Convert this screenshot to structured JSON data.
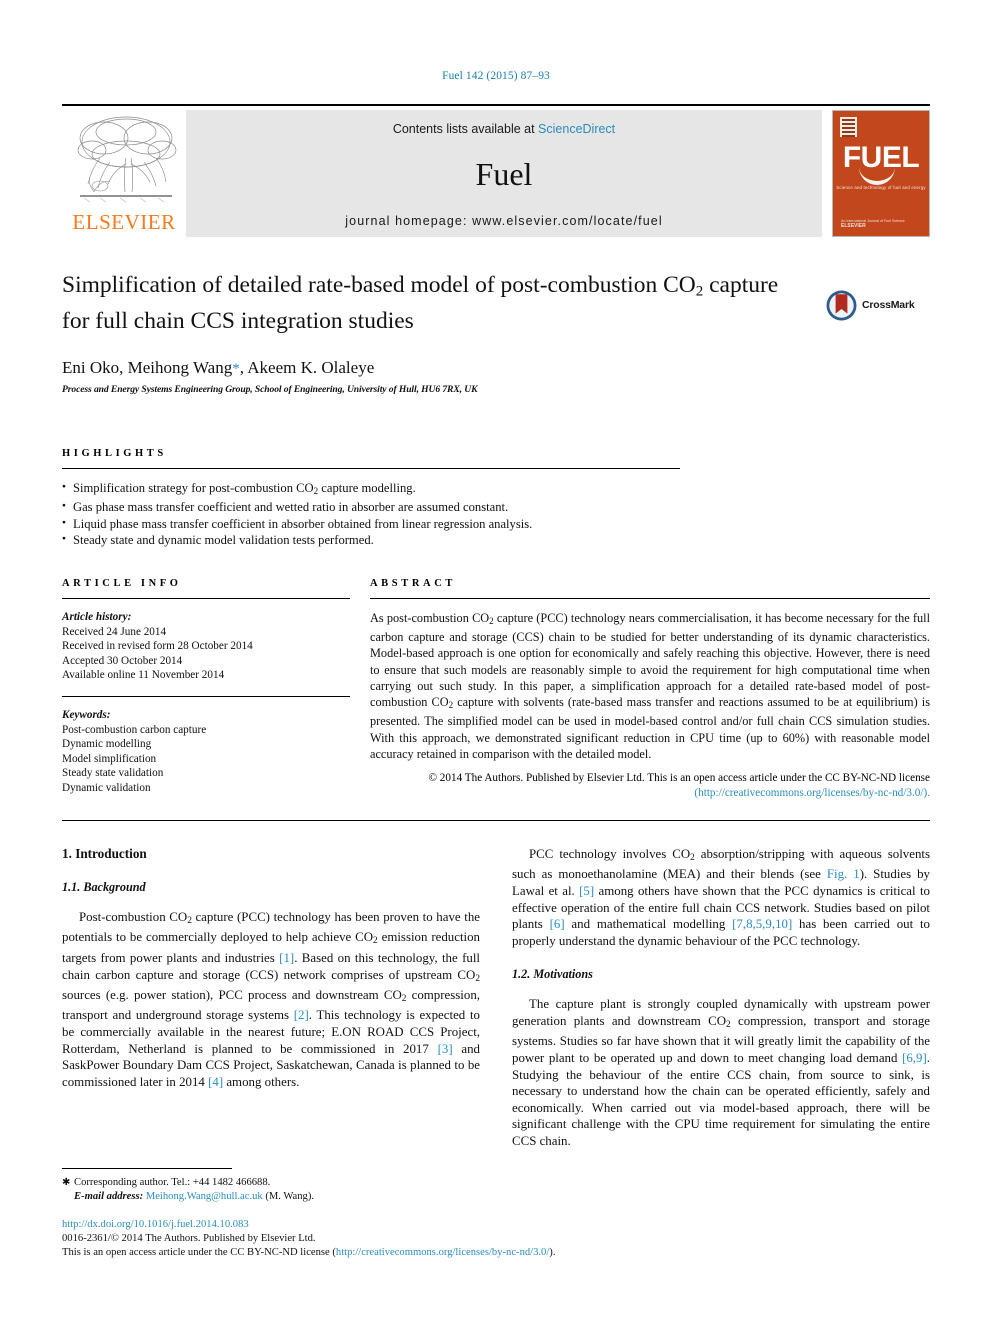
{
  "running_head": "Fuel 142 (2015) 87–93",
  "masthead": {
    "publisher_name": "ELSEVIER",
    "contents_prefix": "Contents lists available at ",
    "contents_link": "ScienceDirect",
    "journal_title": "Fuel",
    "journal_homepage": "journal homepage: www.elsevier.com/locate/fuel",
    "cover": {
      "wordmark": "FUEL",
      "subtitle": "Science and technology of fuel and energy",
      "footer_small": "An International Journal of Fuel Science",
      "footer_bold": "ELSEVIER"
    }
  },
  "article": {
    "title_line1": "Simplification of detailed rate-based model of post-combustion CO",
    "title_sub1": "2",
    "title_line2": "capture for full chain CCS integration studies",
    "crossmark_label": "CrossMark",
    "authors_plain": "Eni Oko, Meihong Wang",
    "corresponding_star": "*",
    "authors_rest": ", Akeem K. Olaleye",
    "affiliation": "Process and Energy Systems Engineering Group, School of Engineering, University of Hull, HU6 7RX, UK"
  },
  "highlights": {
    "heading": "HIGHLIGHTS",
    "items": [
      {
        "pre": "Simplification strategy for post-combustion CO",
        "sub": "2",
        "post": " capture modelling."
      },
      {
        "pre": "Gas phase mass transfer coefficient and wetted ratio in absorber are assumed constant.",
        "sub": "",
        "post": ""
      },
      {
        "pre": "Liquid phase mass transfer coefficient in absorber obtained from linear regression analysis.",
        "sub": "",
        "post": ""
      },
      {
        "pre": "Steady state and dynamic model validation tests performed.",
        "sub": "",
        "post": ""
      }
    ]
  },
  "article_info": {
    "heading": "ARTICLE INFO",
    "history_label": "Article history:",
    "history": [
      "Received 24 June 2014",
      "Received in revised form 28 October 2014",
      "Accepted 30 October 2014",
      "Available online 11 November 2014"
    ],
    "keywords_label": "Keywords:",
    "keywords": [
      "Post-combustion carbon capture",
      "Dynamic modelling",
      "Model simplification",
      "Steady state validation",
      "Dynamic validation"
    ]
  },
  "abstract": {
    "heading": "ABSTRACT",
    "p1_a": "As post-combustion CO",
    "p1_sub1": "2",
    "p1_b": " capture (PCC) technology nears commercialisation, it has become necessary for the full carbon capture and storage (CCS) chain to be studied for better understanding of its dynamic characteristics. Model-based approach is one option for economically and safely reaching this objective. However, there is need to ensure that such models are reasonably simple to avoid the requirement for high computational time when carrying out such study. In this paper, a simplification approach for a detailed rate-based model of post-combustion CO",
    "p1_sub2": "2",
    "p1_c": " capture with solvents (rate-based mass transfer and reactions assumed to be at equilibrium) is presented. The simplified model can be used in model-based control and/or full chain CCS simulation studies. With this approach, we demonstrated significant reduction in CPU time (up to 60%) with reasonable model accuracy retained in comparison with the detailed model.",
    "copyright_text": "© 2014 The Authors. Published by Elsevier Ltd. This is an open access article under the CC BY-NC-ND license",
    "license_url": "(http://creativecommons.org/licenses/by-nc-nd/3.0/)."
  },
  "body": {
    "left": {
      "section_heading": "1. Introduction",
      "subsection_heading": "1.1. Background",
      "p1_a": "Post-combustion CO",
      "p1_sub1": "2",
      "p1_b": " capture (PCC) technology has been proven to have the potentials to be commercially deployed to help achieve CO",
      "p1_sub2": "2",
      "p1_c": " emission reduction targets from power plants and industries ",
      "p1_cite1": "[1]",
      "p1_d": ". Based on this technology, the full chain carbon capture and storage (CCS) network comprises of upstream CO",
      "p1_sub3": "2",
      "p1_e": " sources (e.g. power station), PCC process and downstream CO",
      "p1_sub4": "2",
      "p1_f": " compression, transport and underground storage systems ",
      "p1_cite2": "[2]",
      "p1_g": ". This technology is expected to be commercially available in the nearest future; E.ON ROAD CCS Project, Rotterdam, Netherland is planned to be commissioned in 2017 ",
      "p1_cite3": "[3]",
      "p1_h": " and SaskPower Boundary Dam CCS Project, Saskatchewan, Canada is planned to be commissioned later in 2014 ",
      "p1_cite4": "[4]",
      "p1_i": " among others."
    },
    "right": {
      "p1_a": "PCC technology involves CO",
      "p1_sub1": "2",
      "p1_b": " absorption/stripping with aqueous solvents such as monoethanolamine (MEA) and their blends (see ",
      "p1_figref": "Fig. 1",
      "p1_c": "). Studies by Lawal et al. ",
      "p1_cite1": "[5]",
      "p1_d": " among others have shown that the PCC dynamics is critical to effective operation of the entire full chain CCS network. Studies based on pilot plants ",
      "p1_cite2": "[6]",
      "p1_e": " and mathematical modelling ",
      "p1_cite3": "[7,8,5,9,10]",
      "p1_f": " has been carried out to properly understand the dynamic behaviour of the PCC technology.",
      "subsection_heading": "1.2. Motivations",
      "p2_a": "The capture plant is strongly coupled dynamically with upstream power generation plants and downstream CO",
      "p2_sub1": "2",
      "p2_b": " compression, transport and storage systems. Studies so far have shown that it will greatly limit the capability of the power plant to be operated up and down to meet changing load demand ",
      "p2_cite1": "[6,9]",
      "p2_c": ". Studying the behaviour of the entire CCS chain, from source to sink, is necessary to understand how the chain can be operated efficiently, safely and economically. When carried out via model-based approach, there will be significant challenge with the CPU time requirement for simulating the entire CCS chain."
    }
  },
  "footnotes": {
    "corresponding": "Corresponding author. Tel.: +44 1482 466688.",
    "email_label": "E-mail address:",
    "email": "Meihong.Wang@hull.ac.uk",
    "email_suffix": " (M. Wang).",
    "doi": "http://dx.doi.org/10.1016/j.fuel.2014.10.083",
    "issn_line": "0016-2361/© 2014 The Authors. Published by Elsevier Ltd.",
    "license_prefix": "This is an open access article under the CC BY-NC-ND license (",
    "license_url": "http://creativecommons.org/licenses/by-nc-nd/3.0/",
    "license_suffix": ")."
  },
  "colors": {
    "link": "#2b8cbe",
    "elsevier_orange": "#f47b20",
    "cover_red": "#c2471d",
    "band_gray": "#e6e6e6"
  }
}
